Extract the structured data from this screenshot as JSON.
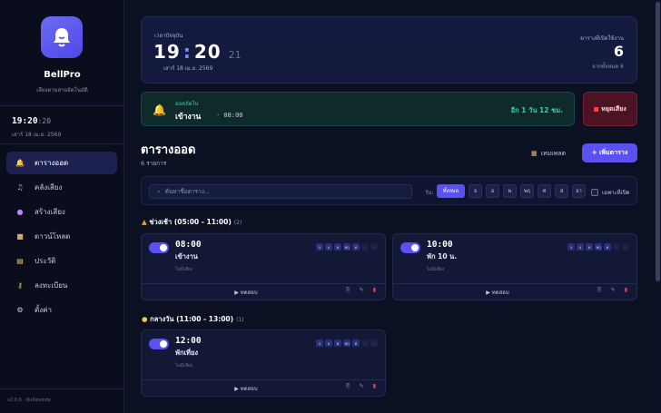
{
  "app": {
    "name": "BellPro",
    "subtitle": "เสียงตามสายอัตโนมัติ",
    "version": "v2.0.0 · DuDevindy"
  },
  "sidebar": {
    "clock": {
      "hm": "19:20",
      "sec": ":20",
      "date": "เสาร์ 18 เม.ย. 2569"
    },
    "items": [
      {
        "label": "ตารางออด",
        "icon": "bell-icon",
        "active": true
      },
      {
        "label": "คลังเสียง",
        "icon": "music-icon"
      },
      {
        "label": "สร้างเสียง",
        "icon": "microphone-icon"
      },
      {
        "label": "ดาวน์โหลด",
        "icon": "package-icon"
      },
      {
        "label": "ประวัติ",
        "icon": "scroll-icon"
      },
      {
        "label": "ลงทะเบียน",
        "icon": "key-icon"
      },
      {
        "label": "ตั้งค่า",
        "icon": "gear-icon"
      }
    ]
  },
  "clock_card": {
    "label": "เวลาปัจจุบัน",
    "hour": "19",
    "minute": "20",
    "second": "21",
    "date": "เสาร์ 18 เม.ย. 2569",
    "right_label": "ตารางที่เปิดใช้งาน",
    "active_count": "6",
    "right_sub": "จากทั้งหมด 6"
  },
  "next_bell": {
    "label": "ออดถัดไป",
    "name": "เข้างาน",
    "time": "· 08:00",
    "countdown": "อีก 1 วัน 12 ชม."
  },
  "stop_button": {
    "label": "หยุดเสียง"
  },
  "schedule": {
    "title": "ตารางออด",
    "count": "6 รายการ",
    "template_label": "เทมเพลต",
    "add_label": "+ เพิ่มตาราง"
  },
  "filter": {
    "search_placeholder": "ค้นหาชื่อตาราง...",
    "day_label": "วัน:",
    "days": [
      "ทั้งหมด",
      "จ",
      "อ",
      "พ",
      "พฤ",
      "ศ",
      "ส",
      "อา"
    ],
    "selected_day": "ทั้งหมด",
    "only_enabled_label": "เฉพาะที่เปิด"
  },
  "groups": [
    {
      "title": "ช่วงเช้า (05:00 - 11:00)",
      "count": "(2)",
      "icon": "sunrise-icon"
    },
    {
      "title": "กลางวัน (11:00 - 13:00)",
      "count": "(1)",
      "icon": "sun-icon"
    }
  ],
  "cards": [
    {
      "time": "08:00",
      "name": "เข้างาน",
      "sound": "ไม่มีเสียง",
      "test_label": "▶ ทดสอบ",
      "enabled": true,
      "day_labels": [
        "จ",
        "อ",
        "พ",
        "พฤ",
        "ศ",
        "ส",
        "อา"
      ],
      "days_on": [
        true,
        true,
        true,
        true,
        true,
        false,
        false
      ]
    },
    {
      "time": "10:00",
      "name": "พัก 10 น.",
      "sound": "ไม่มีเสียง",
      "test_label": "▶ ทดสอบ",
      "enabled": true,
      "day_labels": [
        "จ",
        "อ",
        "พ",
        "พฤ",
        "ศ",
        "ส",
        "อา"
      ],
      "days_on": [
        true,
        true,
        true,
        true,
        true,
        false,
        false
      ]
    },
    {
      "time": "12:00",
      "name": "พักเที่ยง",
      "sound": "ไม่มีเสียง",
      "test_label": "▶ ทดสอบ",
      "enabled": true,
      "day_labels": [
        "จ",
        "อ",
        "พ",
        "พฤ",
        "ศ",
        "ส",
        "อา"
      ],
      "days_on": [
        true,
        true,
        true,
        true,
        true,
        false,
        false
      ]
    }
  ],
  "colors": {
    "accent": "#5b50f0",
    "success": "#34d399",
    "danger": "#ef4444",
    "background": "#0b1023"
  }
}
